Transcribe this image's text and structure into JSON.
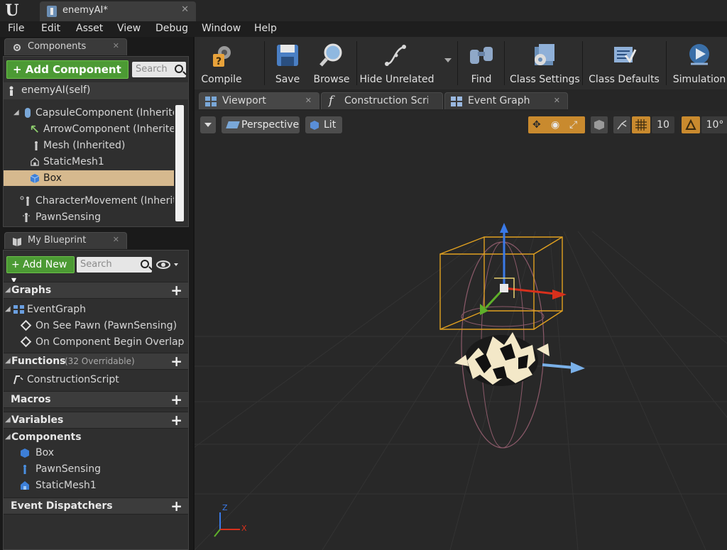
{
  "titlebar": {
    "doc_tab": "enemyAI*"
  },
  "menubar": [
    "File",
    "Edit",
    "Asset",
    "View",
    "Debug",
    "Window",
    "Help"
  ],
  "components": {
    "tab_title": "Components",
    "add_button": "+ Add Component ▾",
    "search_placeholder": "Search",
    "self_label": "enemyAI(self)",
    "tree": [
      "CapsuleComponent (Inherited)",
      "ArrowComponent (Inherited)",
      "Mesh (Inherited)",
      "StaticMesh1",
      "Box",
      "CharacterMovement (Inherited)",
      "PawnSensing"
    ]
  },
  "my_blueprint": {
    "tab_title": "My Blueprint",
    "add_button": "+ Add New ▾",
    "search_placeholder": "Search",
    "graphs_header": "Graphs",
    "event_graph": "EventGraph",
    "events": [
      "On See Pawn (PawnSensing)",
      "On Component Begin Overlap ("
    ],
    "functions_header": "Functions",
    "functions_note": "(32 Overridable)",
    "construction_script": "ConstructionScript",
    "macros_header": "Macros",
    "variables_header": "Variables",
    "components_subheader": "Components",
    "variable_components": [
      "Box",
      "PawnSensing",
      "StaticMesh1"
    ],
    "dispatchers_header": "Event Dispatchers"
  },
  "toolbar": {
    "compile": "Compile",
    "save": "Save",
    "browse": "Browse",
    "hide_unrelated": "Hide Unrelated",
    "find": "Find",
    "class_settings": "Class Settings",
    "class_defaults": "Class Defaults",
    "simulation": "Simulation"
  },
  "editor_tabs": {
    "viewport": "Viewport",
    "construction": "Construction Scrip",
    "event_graph": "Event Graph"
  },
  "viewport": {
    "perspective": "Perspective",
    "lit": "Lit",
    "grid_snap": "10",
    "rot_snap": "10°",
    "axis_x": "X",
    "axis_z": "Z"
  },
  "colors": {
    "green_button": "#4c9a34",
    "selection": "#d6b98e",
    "box_outline": "#e0a020"
  }
}
